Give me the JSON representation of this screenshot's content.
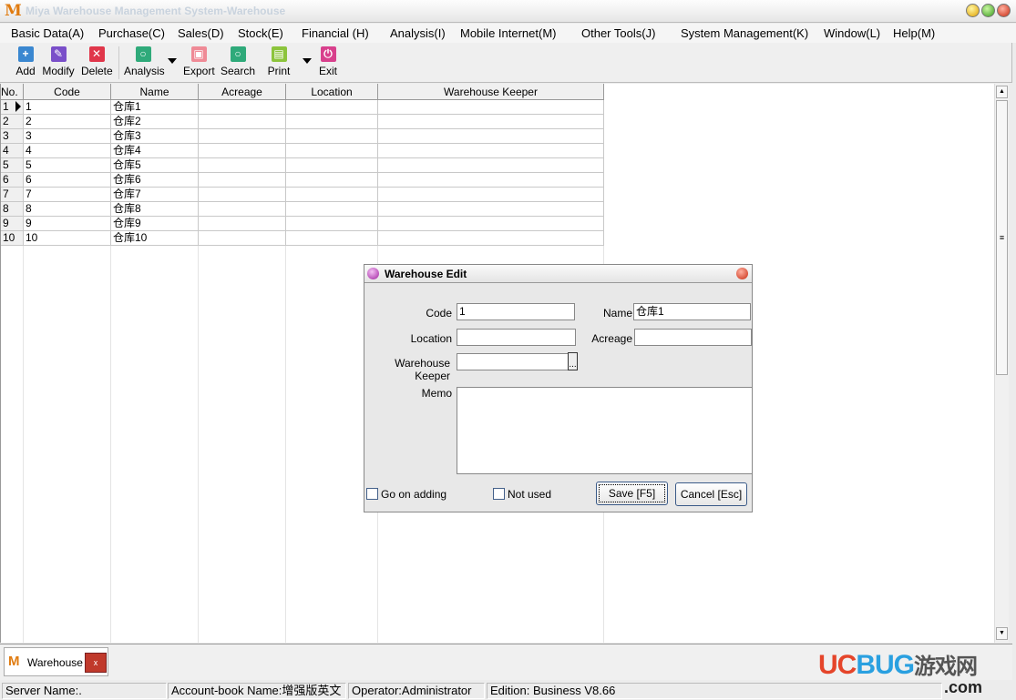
{
  "app": {
    "title": "Miya Warehouse Management System-Warehouse",
    "logo": "M"
  },
  "menu": [
    "Basic Data(A)",
    "Purchase(C)",
    "Sales(D)",
    "Stock(E)",
    "Financial (H)",
    "Analysis(I)",
    "Mobile Internet(M)",
    "Other Tools(J)",
    "System Management(K)",
    "Window(L)",
    "Help(M)"
  ],
  "toolbar": [
    {
      "label": "Add",
      "icon": "plus-icon",
      "color": "#3a87d0"
    },
    {
      "label": "Modify",
      "icon": "edit-icon",
      "color": "#7a4fc9"
    },
    {
      "label": "Delete",
      "icon": "delete-icon",
      "color": "#e0364a"
    },
    {
      "label": "Analysis",
      "icon": "magnifier-icon",
      "color": "#2faa7a"
    },
    {
      "label": "Export",
      "icon": "export-icon",
      "color": "#ef8a96"
    },
    {
      "label": "Search",
      "icon": "search-icon",
      "color": "#2faa7a"
    },
    {
      "label": "Print",
      "icon": "print-icon",
      "color": "#8cc43c"
    },
    {
      "label": "Exit",
      "icon": "power-icon",
      "color": "#d8408c"
    }
  ],
  "grid": {
    "columns": [
      "No.",
      "Code",
      "Name",
      "Acreage",
      "Location",
      "Warehouse Keeper"
    ],
    "rows": [
      [
        "1",
        "1",
        "仓库1"
      ],
      [
        "2",
        "2",
        "仓库2"
      ],
      [
        "3",
        "3",
        "仓库3"
      ],
      [
        "4",
        "4",
        "仓库4"
      ],
      [
        "5",
        "5",
        "仓库5"
      ],
      [
        "6",
        "6",
        "仓库6"
      ],
      [
        "7",
        "7",
        "仓库7"
      ],
      [
        "8",
        "8",
        "仓库8"
      ],
      [
        "9",
        "9",
        "仓库9"
      ],
      [
        "10",
        "10",
        "仓库10"
      ]
    ]
  },
  "dialog": {
    "title": "Warehouse Edit",
    "code_label": "Code",
    "code_value": "1",
    "name_label": "Name",
    "name_value": "仓库1",
    "location_label": "Location",
    "location_value": "",
    "acreage_label": "Acreage",
    "acreage_value": "",
    "keeper_label": "Warehouse Keeper",
    "keeper_value": "",
    "keeper_btn": "...",
    "memo_label": "Memo",
    "memo_value": "",
    "go_on_adding": "Go on adding",
    "go_on_adding_checked": false,
    "not_used": "Not used",
    "not_used_checked": false,
    "save": "Save [F5]",
    "cancel": "Cancel [Esc]"
  },
  "tabs": [
    {
      "label": "Warehouse",
      "close": "x"
    }
  ],
  "watermark": "UCBUG游戏网 .com",
  "status": {
    "server": "Server Name:.",
    "account": "Account-book Name:增强版英文",
    "operator": "Operator:Administrator",
    "edition": "Edition:  Business V8.66"
  }
}
